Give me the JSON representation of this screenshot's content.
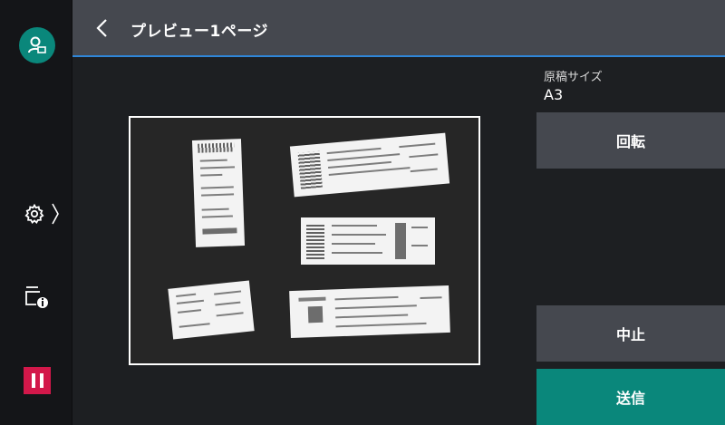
{
  "header": {
    "title": "プレビュー1ページ"
  },
  "sidebar": {
    "icons": [
      "user-icon",
      "gear-icon",
      "chevron-right-icon",
      "job-status-icon",
      "stop-icon"
    ]
  },
  "document": {
    "size_label": "原稿サイズ",
    "size_value": "A3"
  },
  "buttons": {
    "rotate": "回転",
    "cancel": "中止",
    "send": "送信"
  },
  "colors": {
    "accent_teal": "#0a877b",
    "header_rule_blue": "#2f86d8",
    "stop_red": "#d3184a",
    "button_gray": "#45484f"
  }
}
